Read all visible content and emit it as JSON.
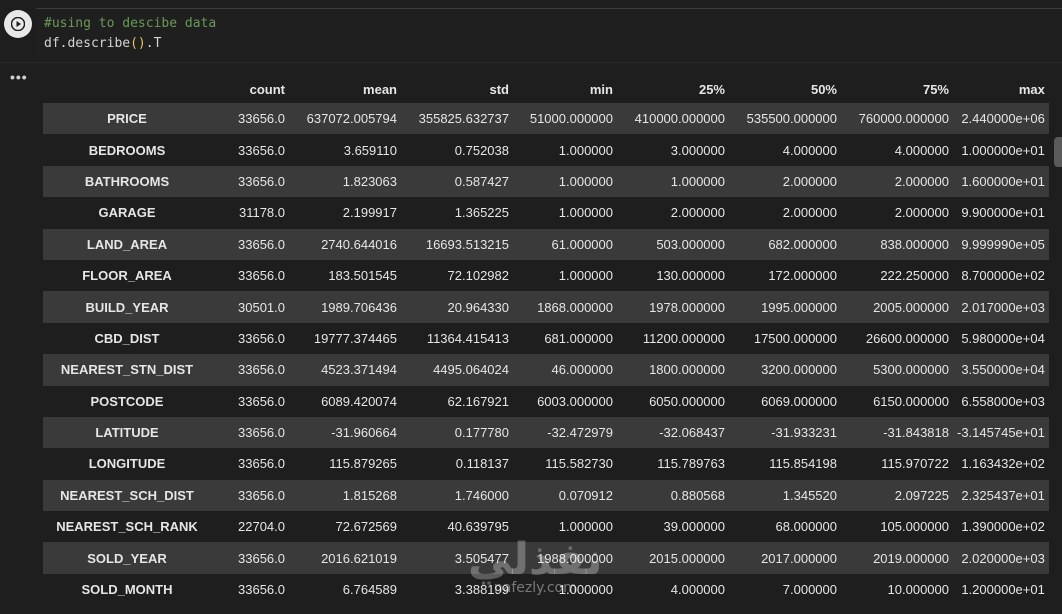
{
  "code_cell": {
    "comment_line": "#using to descibe data",
    "code_prefix": "df.describe",
    "code_parens": "()",
    "code_suffix": ".T"
  },
  "output": {
    "more_icon": "more-horizontal-icon",
    "table": {
      "columns": [
        "count",
        "mean",
        "std",
        "min",
        "25%",
        "50%",
        "75%",
        "max"
      ],
      "rows": [
        {
          "index": "PRICE",
          "cells": [
            "33656.0",
            "637072.005794",
            "355825.632737",
            "51000.000000",
            "410000.000000",
            "535500.000000",
            "760000.000000",
            "2.440000e+06"
          ]
        },
        {
          "index": "BEDROOMS",
          "cells": [
            "33656.0",
            "3.659110",
            "0.752038",
            "1.000000",
            "3.000000",
            "4.000000",
            "4.000000",
            "1.000000e+01"
          ]
        },
        {
          "index": "BATHROOMS",
          "cells": [
            "33656.0",
            "1.823063",
            "0.587427",
            "1.000000",
            "1.000000",
            "2.000000",
            "2.000000",
            "1.600000e+01"
          ]
        },
        {
          "index": "GARAGE",
          "cells": [
            "31178.0",
            "2.199917",
            "1.365225",
            "1.000000",
            "2.000000",
            "2.000000",
            "2.000000",
            "9.900000e+01"
          ]
        },
        {
          "index": "LAND_AREA",
          "cells": [
            "33656.0",
            "2740.644016",
            "16693.513215",
            "61.000000",
            "503.000000",
            "682.000000",
            "838.000000",
            "9.999990e+05"
          ]
        },
        {
          "index": "FLOOR_AREA",
          "cells": [
            "33656.0",
            "183.501545",
            "72.102982",
            "1.000000",
            "130.000000",
            "172.000000",
            "222.250000",
            "8.700000e+02"
          ]
        },
        {
          "index": "BUILD_YEAR",
          "cells": [
            "30501.0",
            "1989.706436",
            "20.964330",
            "1868.000000",
            "1978.000000",
            "1995.000000",
            "2005.000000",
            "2.017000e+03"
          ]
        },
        {
          "index": "CBD_DIST",
          "cells": [
            "33656.0",
            "19777.374465",
            "11364.415413",
            "681.000000",
            "11200.000000",
            "17500.000000",
            "26600.000000",
            "5.980000e+04"
          ]
        },
        {
          "index": "NEAREST_STN_DIST",
          "cells": [
            "33656.0",
            "4523.371494",
            "4495.064024",
            "46.000000",
            "1800.000000",
            "3200.000000",
            "5300.000000",
            "3.550000e+04"
          ]
        },
        {
          "index": "POSTCODE",
          "cells": [
            "33656.0",
            "6089.420074",
            "62.167921",
            "6003.000000",
            "6050.000000",
            "6069.000000",
            "6150.000000",
            "6.558000e+03"
          ]
        },
        {
          "index": "LATITUDE",
          "cells": [
            "33656.0",
            "-31.960664",
            "0.177780",
            "-32.472979",
            "-32.068437",
            "-31.933231",
            "-31.843818",
            "-3.145745e+01"
          ]
        },
        {
          "index": "LONGITUDE",
          "cells": [
            "33656.0",
            "115.879265",
            "0.118137",
            "115.582730",
            "115.789763",
            "115.854198",
            "115.970722",
            "1.163432e+02"
          ]
        },
        {
          "index": "NEAREST_SCH_DIST",
          "cells": [
            "33656.0",
            "1.815268",
            "1.746000",
            "0.070912",
            "0.880568",
            "1.345520",
            "2.097225",
            "2.325437e+01"
          ]
        },
        {
          "index": "NEAREST_SCH_RANK",
          "cells": [
            "22704.0",
            "72.672569",
            "40.639795",
            "1.000000",
            "39.000000",
            "68.000000",
            "105.000000",
            "1.390000e+02"
          ]
        },
        {
          "index": "SOLD_YEAR",
          "cells": [
            "33656.0",
            "2016.621019",
            "3.505477",
            "1988.000000",
            "2015.000000",
            "2017.000000",
            "2019.000000",
            "2.020000e+03"
          ]
        },
        {
          "index": "SOLD_MONTH",
          "cells": [
            "33656.0",
            "6.764589",
            "3.388199",
            "1.000000",
            "4.000000",
            "7.000000",
            "10.000000",
            "1.200000e+01"
          ]
        }
      ]
    }
  },
  "watermark": {
    "logo_text": "نفذلي",
    "url": "nafezly.com"
  }
}
